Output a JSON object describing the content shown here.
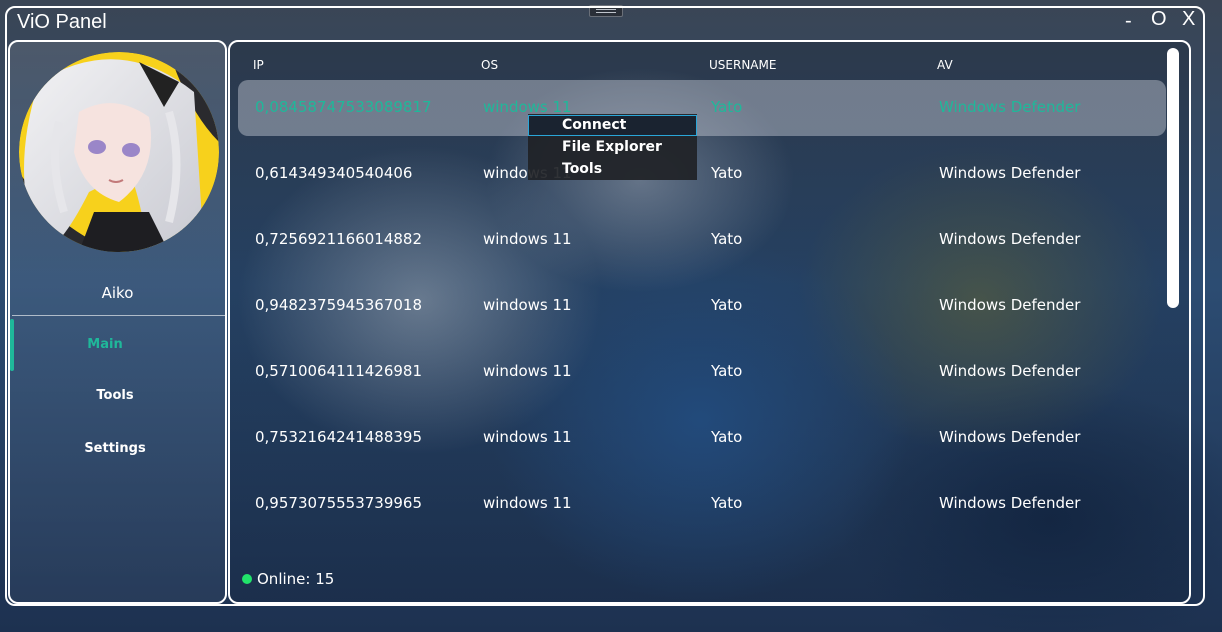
{
  "window": {
    "title": "ViO Panel",
    "controls": {
      "minimize": "-",
      "maximize": "O",
      "close": "X"
    }
  },
  "sidebar": {
    "user_name": "Aiko",
    "nav": [
      {
        "label": "Main",
        "active": true
      },
      {
        "label": "Tools",
        "active": false
      },
      {
        "label": "Settings",
        "active": false
      }
    ]
  },
  "table": {
    "columns": [
      "IP",
      "OS",
      "USERNAME",
      "AV"
    ],
    "rows": [
      {
        "ip": "0,08458747533089817",
        "os": "windows 11",
        "username": "Yato",
        "av": "Windows Defender",
        "selected": true
      },
      {
        "ip": "0,614349340540406",
        "os": "windows 11",
        "username": "Yato",
        "av": "Windows Defender"
      },
      {
        "ip": "0,7256921166014882",
        "os": "windows 11",
        "username": "Yato",
        "av": "Windows Defender"
      },
      {
        "ip": "0,9482375945367018",
        "os": "windows 11",
        "username": "Yato",
        "av": "Windows Defender"
      },
      {
        "ip": "0,5710064111426981",
        "os": "windows 11",
        "username": "Yato",
        "av": "Windows Defender"
      },
      {
        "ip": "0,7532164241488395",
        "os": "windows 11",
        "username": "Yato",
        "av": "Windows Defender"
      },
      {
        "ip": "0,9573075553739965",
        "os": "windows 11",
        "username": "Yato",
        "av": "Windows Defender"
      }
    ]
  },
  "status": {
    "online": "Online: 15"
  },
  "context_menu": {
    "items": [
      "Connect",
      "File Explorer",
      "Tools"
    ],
    "highlighted": "Connect"
  },
  "colors": {
    "accent": "#1fb89a",
    "online_dot": "#21e36a",
    "menu_highlight_border": "#2aa6d8"
  }
}
